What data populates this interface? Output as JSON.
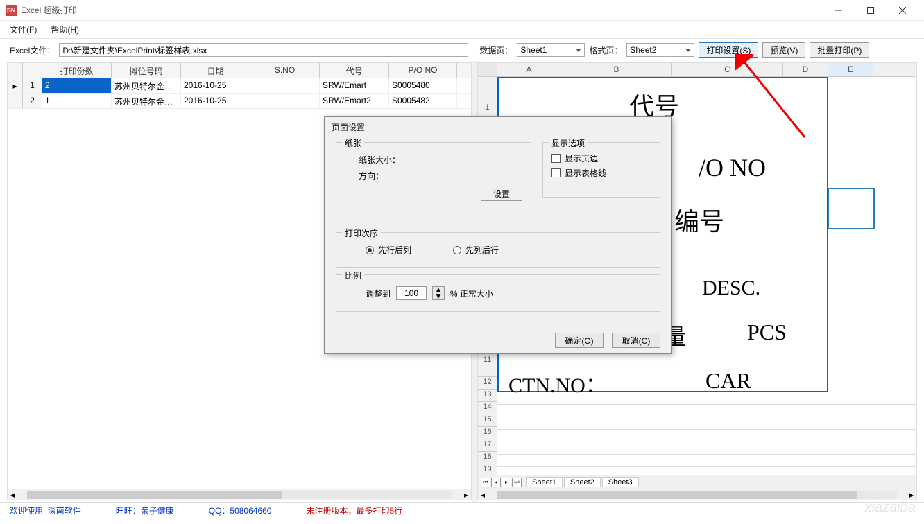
{
  "window": {
    "title": "Excel 超级打印"
  },
  "app_icon_text": "SN",
  "menubar": {
    "file": "文件(F)",
    "help": "帮助(H)"
  },
  "toolbar": {
    "file_label": "Excel文件：",
    "file_path": "D:\\新建文件夹\\ExcelPrint\\标签样表.xlsx",
    "data_page_label": "数据页：",
    "data_page_value": "Sheet1",
    "format_page_label": "格式页：",
    "format_page_value": "Sheet2",
    "print_settings": "打印设置(S)",
    "preview": "预览(V)",
    "batch_print": "批量打印(P)"
  },
  "grid": {
    "headers": {
      "copies": "打印份数",
      "booth": "摊位号码",
      "date": "日期",
      "sno": "S.NO",
      "code": "代号",
      "po": "P/O NO"
    },
    "rows": [
      {
        "num": "1",
        "copies": "2",
        "booth": "苏州贝特尔金…",
        "date": "2016-10-25",
        "sno": "",
        "code": "SRW/Emart",
        "po": "S0005480",
        "selected": true
      },
      {
        "num": "2",
        "copies": "1",
        "booth": "苏州贝特尔金…",
        "date": "2016-10-25",
        "sno": "",
        "code": "SRW/Emart2",
        "po": "S0005482",
        "selected": false
      }
    ]
  },
  "sheet": {
    "cols": [
      "A",
      "B",
      "C",
      "D",
      "E"
    ],
    "row_nums": [
      "1",
      "",
      "",
      "",
      "",
      "",
      "",
      "",
      "",
      "",
      "11",
      "12",
      "13",
      "14",
      "15",
      "16",
      "17",
      "18",
      "19"
    ],
    "row_tall_idx": [
      0
    ],
    "content": {
      "r1": "代号",
      "r2": "/O NO",
      "r3": "编号",
      "r4": "DESC.",
      "r5a": "量",
      "r5b": "PCS",
      "r6a": "CTN.NO：",
      "r6b": "CAR"
    },
    "tabs": [
      "Sheet1",
      "Sheet2",
      "Sheet3"
    ],
    "active_tab": 1
  },
  "dialog": {
    "title": "页面设置",
    "paper_group": "纸张",
    "paper_size_label": "纸张大小：",
    "orientation_label": "方向：",
    "settings_btn": "设置",
    "display_group": "显示选项",
    "show_margins": "显示页边",
    "show_gridlines": "显示表格线",
    "print_order_group": "打印次序",
    "row_first": "先行后列",
    "col_first": "先列后行",
    "scale_group": "比例",
    "adjust_to": "调整到",
    "scale_value": "100",
    "normal_size": "% 正常大小",
    "ok": "确定(O)",
    "cancel": "取消(C)"
  },
  "statusbar": {
    "welcome": "欢迎使用",
    "company": "深南软件",
    "wangwang_label": "旺旺：",
    "wangwang_value": "亲子健康",
    "qq_label": "QQ：",
    "qq_value": "508064660",
    "unregistered": "未注册版本，最多打印5行"
  },
  "watermark": "xiazaiba"
}
